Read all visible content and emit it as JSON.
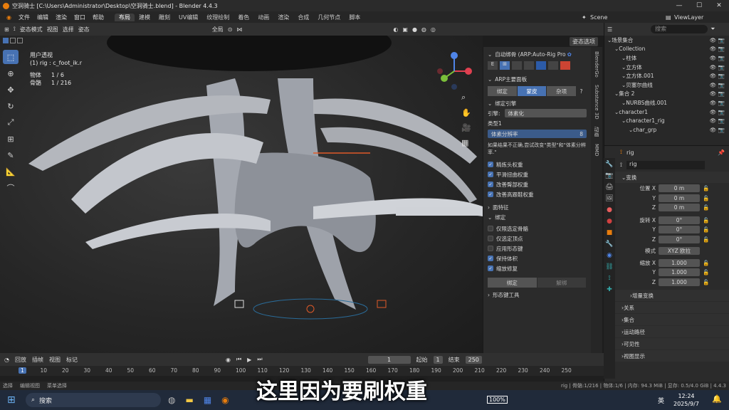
{
  "titlebar": {
    "title": "空洞骑士 [C:\\Users\\Administrator\\Desktop\\空洞骑士.blend] - Blender 4.4.3"
  },
  "menubar": {
    "items": [
      "文件",
      "编辑",
      "渲染",
      "窗口",
      "帮助"
    ],
    "workspaces": [
      "布局",
      "建模",
      "雕刻",
      "UV编辑",
      "纹理绘制",
      "着色",
      "动画",
      "渲染",
      "合成",
      "几何节点",
      "脚本"
    ],
    "scene": "Scene",
    "view_layer": "ViewLayer"
  },
  "viewport_header": {
    "mode": "姿态模式",
    "menus": [
      "视图",
      "选择",
      "姿态"
    ],
    "transform": "全局",
    "options": "姿态选项"
  },
  "viewport_info": {
    "view": "用户透视",
    "object": "(1) rig : c_foot_ik.r",
    "objects_label": "物体",
    "objects_value": "1 / 6",
    "bones_label": "骨骼",
    "bones_value": "1 / 216"
  },
  "arp": {
    "title": "自动绑骨 (ARP:Auto-Rig Pro",
    "main_panel": "ARP主要面板",
    "tabs": [
      "绑定",
      "蒙皮",
      "杂项"
    ],
    "bind_engine_section": "绑定引擎",
    "engine_label": "引擎:",
    "engine_value": "体素化",
    "type_label": "类型1",
    "resolution_label": "体素分辨率",
    "resolution_value": "8",
    "hint": "如果结果不正确,尝试改变\"类型\"和\"体素分辨率.\"",
    "options": [
      {
        "label": "精炼头权重",
        "checked": true
      },
      {
        "label": "平滑扭曲权重",
        "checked": true
      },
      {
        "label": "改善臀部权重",
        "checked": true
      },
      {
        "label": "改善高跟鞋权重",
        "checked": true
      }
    ],
    "sub_sections": [
      "面特征",
      "绑定"
    ],
    "bind_options": [
      {
        "label": "仅限选定骨骼",
        "checked": false
      },
      {
        "label": "仅选定顶点",
        "checked": false
      },
      {
        "label": "应用形态键",
        "checked": false
      },
      {
        "label": "保持体积",
        "checked": true
      },
      {
        "label": "缩放修复",
        "checked": true
      }
    ],
    "bind_btn": "绑定",
    "unbind_btn": "解绑",
    "shapekeys": "形态键工具"
  },
  "side_tabs": [
    "BlenderGo",
    "Substance 3D",
    "动画",
    "MMD"
  ],
  "outliner": {
    "search_placeholder": "搜索",
    "rows": [
      {
        "label": "场景集合",
        "indent": 0
      },
      {
        "label": "Collection",
        "indent": 1
      },
      {
        "label": "柱体",
        "indent": 2
      },
      {
        "label": "立方体",
        "indent": 2
      },
      {
        "label": "立方体.001",
        "indent": 2
      },
      {
        "label": "贝塞尔曲线",
        "indent": 2
      },
      {
        "label": "集合 2",
        "indent": 1
      },
      {
        "label": "NURBS曲线.001",
        "indent": 2
      },
      {
        "label": "character1",
        "indent": 1
      },
      {
        "label": "character1_rig",
        "indent": 2
      },
      {
        "label": "char_grp",
        "indent": 3
      }
    ]
  },
  "properties": {
    "object": "rig",
    "data": "rig",
    "transform": "变换",
    "location_label": "位置",
    "rotation_label": "旋转",
    "rotation_mode_label": "模式",
    "rotation_mode": "XYZ 欧拉",
    "scale_label": "缩放",
    "axes": [
      "X",
      "Y",
      "Z"
    ],
    "location": [
      "0 m",
      "0 m",
      "0 m"
    ],
    "rotation": [
      "0°",
      "0°",
      "0°"
    ],
    "scale": [
      "1.000",
      "1.000",
      "1.000"
    ],
    "delta": "增量变换",
    "sections": [
      "关系",
      "集合",
      "运动路径",
      "可见性",
      "视图显示"
    ]
  },
  "timeline": {
    "menus": [
      "回放",
      "插帧",
      "视图",
      "标记"
    ],
    "current_frame": "1",
    "start_label": "起始",
    "start": "1",
    "end_label": "结束",
    "end": "250",
    "ticks": [
      "1",
      "10",
      "20",
      "30",
      "40",
      "50",
      "60",
      "70",
      "80",
      "90",
      "100",
      "110",
      "120",
      "130",
      "140",
      "150",
      "160",
      "170",
      "180",
      "190",
      "200",
      "210",
      "220",
      "230",
      "240",
      "250"
    ]
  },
  "status": {
    "select": "选择",
    "edit_view": "编辑视图",
    "menu": "菜单选择",
    "right": "rig | 骨骼:1/216 | 物体:1/6 | 内存: 94.3 MiB | 显存: 0.5/4.0 GiB | 4.4.3"
  },
  "taskbar": {
    "search": "搜索",
    "time": "12:24",
    "date": "2025/9/7",
    "lang": "英",
    "battery": "100%"
  },
  "subtitle": "这里因为要刷权重"
}
